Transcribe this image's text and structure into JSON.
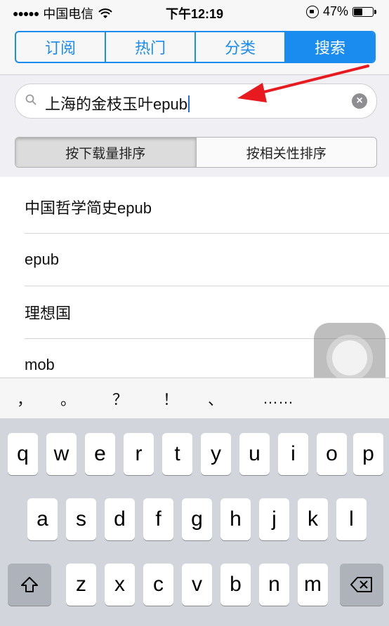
{
  "status_bar": {
    "signal_dots": "●●●●●",
    "carrier": "中国电信",
    "time": "下午12:19",
    "battery_percent": "47%",
    "battery_level": 0.47
  },
  "nav_tabs": [
    {
      "label": "订阅",
      "active": false
    },
    {
      "label": "热门",
      "active": false
    },
    {
      "label": "分类",
      "active": false
    },
    {
      "label": "搜索",
      "active": true
    }
  ],
  "search": {
    "value": "上海的金枝玉叶epub",
    "clear_icon": "×"
  },
  "sort_options": [
    {
      "label": "按下载量排序",
      "active": true
    },
    {
      "label": "按相关性排序",
      "active": false
    }
  ],
  "suggestions": [
    "中国哲学简史epub",
    "epub",
    "理想国",
    "mob"
  ],
  "quicktype": [
    "，",
    "。",
    "？",
    "！",
    "、",
    "……"
  ],
  "keyboard": {
    "row1": [
      "q",
      "w",
      "e",
      "r",
      "t",
      "y",
      "u",
      "i",
      "o",
      "p"
    ],
    "row2": [
      "a",
      "s",
      "d",
      "f",
      "g",
      "h",
      "j",
      "k",
      "l"
    ],
    "row3": [
      "z",
      "x",
      "c",
      "v",
      "b",
      "n",
      "m"
    ]
  },
  "colors": {
    "accent": "#1a8cf0",
    "annotation_arrow": "#e8191f"
  }
}
